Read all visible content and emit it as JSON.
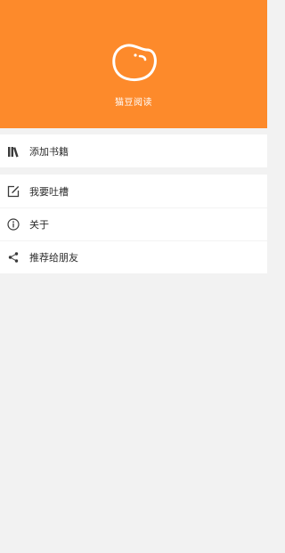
{
  "header": {
    "app_name": "猫豆阅读",
    "logo_icon": "bean-icon",
    "background": "#fd8a2b"
  },
  "menu": {
    "groups": [
      {
        "items": [
          {
            "label": "添加书籍",
            "icon": "books-icon"
          }
        ]
      },
      {
        "items": [
          {
            "label": "我要吐槽",
            "icon": "edit-icon"
          },
          {
            "label": "关于",
            "icon": "info-icon"
          },
          {
            "label": "推荐给朋友",
            "icon": "share-icon"
          }
        ]
      }
    ]
  }
}
